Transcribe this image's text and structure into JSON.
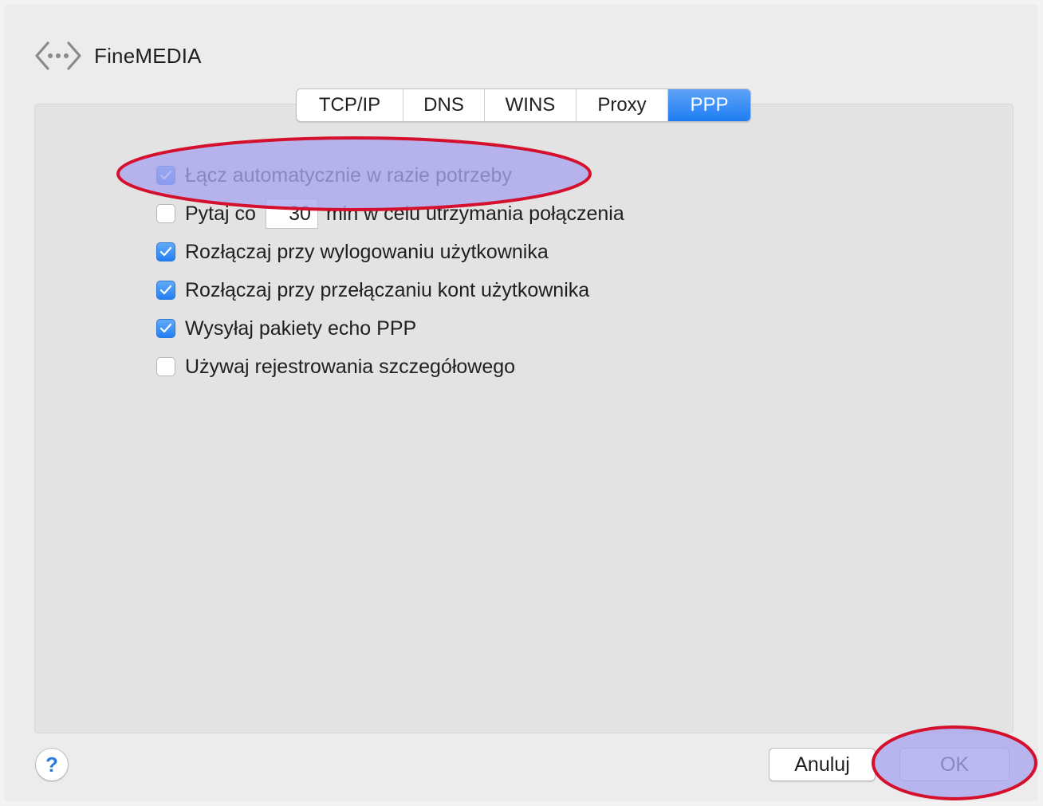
{
  "header": {
    "icon": "network-arrows-icon",
    "title": "FineMEDIA"
  },
  "tabs": [
    {
      "label": "TCP/IP",
      "active": false
    },
    {
      "label": "DNS",
      "active": false
    },
    {
      "label": "WINS",
      "active": false
    },
    {
      "label": "Proxy",
      "active": false
    },
    {
      "label": "PPP",
      "active": true
    }
  ],
  "options": {
    "auto_connect": {
      "label": "Łącz automatycznie w razie potrzeby",
      "checked": true
    },
    "prompt_every": {
      "prefix": "Pytaj co",
      "minutes": "30",
      "suffix": "min w celu utrzymania połączenia",
      "checked": false
    },
    "disconnect_logout": {
      "label": "Rozłączaj przy wylogowaniu użytkownika",
      "checked": true
    },
    "disconnect_switch": {
      "label": "Rozłączaj przy przełączaniu kont użytkownika",
      "checked": true
    },
    "send_echo": {
      "label": "Wysyłaj pakiety echo PPP",
      "checked": true
    },
    "verbose_logging": {
      "label": "Używaj rejestrowania szczegółowego",
      "checked": false
    }
  },
  "footer": {
    "help_label": "?",
    "cancel_label": "Anuluj",
    "ok_label": "OK"
  },
  "colors": {
    "accent": "#2380f2",
    "highlight_fill": "#a8a4ee",
    "highlight_stroke": "#d4102c"
  }
}
